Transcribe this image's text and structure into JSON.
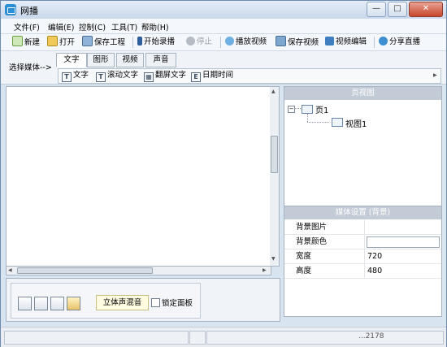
{
  "window": {
    "title": "网播",
    "controls": [
      "—",
      "□",
      "✕"
    ]
  },
  "menu": [
    "文件(F)",
    "编辑(E)",
    "控制(C)",
    "工具(T)",
    "帮助(H)"
  ],
  "toolbar": {
    "new": "新建",
    "open": "打开",
    "save_project": "保存工程",
    "start_record": "开始录播",
    "stop": "停止",
    "play_video": "播放视频",
    "save_video": "保存视频",
    "video_edit": "视频编辑",
    "share_live": "分享直播"
  },
  "media": {
    "label": "选择媒体-->",
    "tabs": [
      "文字",
      "图形",
      "视频",
      "声音"
    ],
    "sub": [
      "文字",
      "滚动文字",
      "翻屏文字",
      "日期时间"
    ],
    "more": "▸"
  },
  "page_view": {
    "title": "页视图",
    "tree": {
      "node": "页1",
      "child": "视图1"
    }
  },
  "media_settings": {
    "title": "媒体设置 (背景)",
    "rows": [
      {
        "key": "背景图片",
        "value": ""
      },
      {
        "key": "背景颜色",
        "value": ""
      },
      {
        "key": "宽度",
        "value": "720"
      },
      {
        "key": "高度",
        "value": "480"
      }
    ]
  },
  "bottom": {
    "mix_label": "立体声混音",
    "lock_label": "锁定面板"
  },
  "status": {
    "text": "...2178"
  },
  "colors": {
    "accent": "#2b8fd6",
    "record": "#2e5f9c",
    "watermark": "#e36b1a"
  }
}
